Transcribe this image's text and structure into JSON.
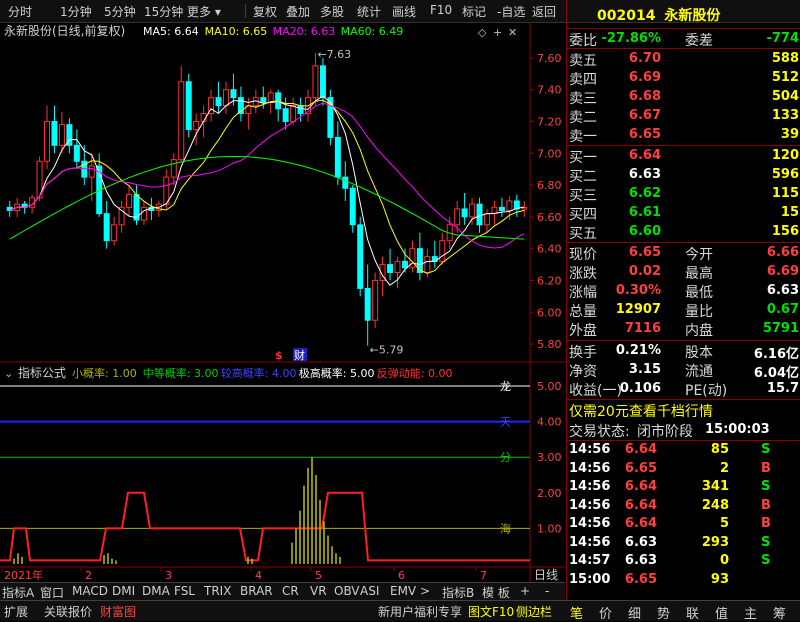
{
  "toolbar": {
    "items": [
      "分时",
      "1分钟",
      "5分钟",
      "15分钟",
      "更多",
      "复权",
      "叠加",
      "多股",
      "统计",
      "画线",
      "F10",
      "标记",
      "-自选",
      "返回"
    ]
  },
  "chart": {
    "title": "永新股份(日线,前复权)",
    "ma_labels": [
      {
        "text": "MA5: 6.64",
        "color": "#ffffff"
      },
      {
        "text": "MA10: 6.65",
        "color": "#ffff00"
      },
      {
        "text": "MA20: 6.63",
        "color": "#ff00ff"
      },
      {
        "text": "MA60: 6.49",
        "color": "#00ff00"
      }
    ],
    "price_ticks": [
      "7.60",
      "7.40",
      "7.20",
      "7.00",
      "6.80",
      "6.60",
      "6.40",
      "6.20",
      "6.00",
      "5.80"
    ],
    "high_label": "7.63",
    "low_label": "5.79",
    "markers": {
      "s": "$",
      "cai": "财"
    },
    "indicator": {
      "name": "指标公式",
      "params": [
        {
          "text": "小概率: 1.00",
          "color": "#b0b000"
        },
        {
          "text": "中等概率: 3.00",
          "color": "#00d000"
        },
        {
          "text": "较高概率: 4.00",
          "color": "#4040ff"
        },
        {
          "text": "极高概率: 5.00",
          "color": "#ffffff"
        },
        {
          "text": "反弹动能: 0.00",
          "color": "#ff3030"
        }
      ],
      "ticks": [
        "5.00",
        "4.00",
        "3.00",
        "2.00",
        "1.00"
      ],
      "line_labels": [
        {
          "text": "龙",
          "color": "#ffffff"
        },
        {
          "text": "天",
          "color": "#4040ff"
        },
        {
          "text": "分",
          "color": "#00d000"
        },
        {
          "text": "海",
          "color": "#b0b000"
        }
      ]
    },
    "x_labels": [
      "2021年",
      "2",
      "3",
      "4",
      "5",
      "6",
      "7"
    ],
    "x_right_label": "日线"
  },
  "chart_data": {
    "type": "candlestick",
    "ylim": [
      5.75,
      7.7
    ],
    "candles": [
      [
        6.66,
        6.7,
        6.6,
        6.64
      ],
      [
        6.64,
        6.72,
        6.6,
        6.68
      ],
      [
        6.68,
        6.7,
        6.62,
        6.66
      ],
      [
        6.66,
        6.74,
        6.62,
        6.72
      ],
      [
        6.72,
        6.98,
        6.7,
        6.95
      ],
      [
        6.95,
        7.3,
        6.9,
        7.2
      ],
      [
        7.2,
        7.3,
        7.0,
        7.05
      ],
      [
        7.05,
        7.26,
        7.0,
        7.18
      ],
      [
        7.18,
        7.22,
        7.0,
        7.05
      ],
      [
        7.05,
        7.15,
        6.9,
        6.95
      ],
      [
        6.95,
        7.05,
        6.8,
        6.85
      ],
      [
        6.85,
        7.0,
        6.7,
        6.92
      ],
      [
        6.92,
        7.0,
        6.6,
        6.62
      ],
      [
        6.62,
        6.7,
        6.4,
        6.45
      ],
      [
        6.45,
        6.6,
        6.42,
        6.55
      ],
      [
        6.55,
        6.7,
        6.5,
        6.66
      ],
      [
        6.66,
        6.8,
        6.6,
        6.74
      ],
      [
        6.74,
        6.8,
        6.55,
        6.58
      ],
      [
        6.58,
        6.7,
        6.55,
        6.66
      ],
      [
        6.66,
        6.72,
        6.58,
        6.64
      ],
      [
        6.64,
        6.7,
        6.6,
        6.68
      ],
      [
        6.68,
        6.9,
        6.65,
        6.85
      ],
      [
        6.85,
        7.0,
        6.8,
        6.96
      ],
      [
        6.96,
        7.55,
        6.95,
        7.45
      ],
      [
        7.45,
        7.5,
        7.1,
        7.15
      ],
      [
        7.15,
        7.25,
        7.05,
        7.2
      ],
      [
        7.2,
        7.3,
        7.1,
        7.25
      ],
      [
        7.25,
        7.4,
        7.2,
        7.35
      ],
      [
        7.35,
        7.45,
        7.25,
        7.3
      ],
      [
        7.3,
        7.45,
        7.25,
        7.4
      ],
      [
        7.4,
        7.5,
        7.3,
        7.35
      ],
      [
        7.35,
        7.42,
        7.2,
        7.25
      ],
      [
        7.25,
        7.35,
        7.15,
        7.3
      ],
      [
        7.3,
        7.4,
        7.25,
        7.35
      ],
      [
        7.35,
        7.42,
        7.28,
        7.32
      ],
      [
        7.32,
        7.4,
        7.25,
        7.38
      ],
      [
        7.38,
        7.4,
        7.2,
        7.28
      ],
      [
        7.28,
        7.35,
        7.15,
        7.2
      ],
      [
        7.2,
        7.35,
        7.18,
        7.3
      ],
      [
        7.3,
        7.35,
        7.2,
        7.25
      ],
      [
        7.25,
        7.4,
        7.2,
        7.35
      ],
      [
        7.35,
        7.63,
        7.3,
        7.55
      ],
      [
        7.55,
        7.6,
        7.3,
        7.35
      ],
      [
        7.35,
        7.4,
        7.05,
        7.1
      ],
      [
        7.1,
        7.2,
        6.8,
        6.85
      ],
      [
        6.85,
        6.95,
        6.7,
        6.78
      ],
      [
        6.78,
        6.8,
        6.5,
        6.55
      ],
      [
        6.55,
        6.6,
        6.1,
        6.15
      ],
      [
        6.15,
        6.3,
        5.79,
        5.95
      ],
      [
        5.95,
        6.25,
        5.9,
        6.2
      ],
      [
        6.2,
        6.35,
        6.1,
        6.3
      ],
      [
        6.3,
        6.4,
        6.2,
        6.25
      ],
      [
        6.25,
        6.35,
        6.15,
        6.32
      ],
      [
        6.32,
        6.4,
        6.25,
        6.28
      ],
      [
        6.28,
        6.45,
        6.25,
        6.4
      ],
      [
        6.4,
        6.5,
        6.2,
        6.25
      ],
      [
        6.25,
        6.4,
        6.22,
        6.35
      ],
      [
        6.35,
        6.45,
        6.28,
        6.32
      ],
      [
        6.32,
        6.5,
        6.3,
        6.45
      ],
      [
        6.45,
        6.6,
        6.4,
        6.55
      ],
      [
        6.55,
        6.7,
        6.5,
        6.65
      ],
      [
        6.65,
        6.75,
        6.55,
        6.6
      ],
      [
        6.6,
        6.72,
        6.55,
        6.68
      ],
      [
        6.68,
        6.72,
        6.5,
        6.55
      ],
      [
        6.55,
        6.65,
        6.5,
        6.62
      ],
      [
        6.62,
        6.7,
        6.55,
        6.66
      ],
      [
        6.66,
        6.72,
        6.6,
        6.64
      ],
      [
        6.64,
        6.73,
        6.58,
        6.7
      ],
      [
        6.7,
        6.74,
        6.6,
        6.65
      ],
      [
        6.65,
        6.7,
        6.6,
        6.66
      ]
    ]
  },
  "quote": {
    "code": "002014",
    "name": "永新股份",
    "weibi": {
      "label": "委比",
      "value": "-27.86%",
      "label2": "委差",
      "value2": "-774"
    },
    "sell": [
      {
        "label": "卖五",
        "price": "6.70",
        "vol": "588"
      },
      {
        "label": "卖四",
        "price": "6.69",
        "vol": "512"
      },
      {
        "label": "卖三",
        "price": "6.68",
        "vol": "504"
      },
      {
        "label": "卖二",
        "price": "6.67",
        "vol": "133"
      },
      {
        "label": "卖一",
        "price": "6.65",
        "vol": "39"
      }
    ],
    "buy": [
      {
        "label": "买一",
        "price": "6.64",
        "vol": "120",
        "pc": "red"
      },
      {
        "label": "买二",
        "price": "6.63",
        "vol": "596",
        "pc": "white"
      },
      {
        "label": "买三",
        "price": "6.62",
        "vol": "115",
        "pc": "green"
      },
      {
        "label": "买四",
        "price": "6.61",
        "vol": "15",
        "pc": "green"
      },
      {
        "label": "买五",
        "price": "6.60",
        "vol": "156",
        "pc": "green"
      }
    ],
    "stats": [
      {
        "l1": "现价",
        "v1": "6.65",
        "c1": "red",
        "l2": "今开",
        "v2": "6.66",
        "c2": "red"
      },
      {
        "l1": "涨跌",
        "v1": "0.02",
        "c1": "red",
        "l2": "最高",
        "v2": "6.69",
        "c2": "red"
      },
      {
        "l1": "涨幅",
        "v1": "0.30%",
        "c1": "red",
        "l2": "最低",
        "v2": "6.63",
        "c2": "white"
      },
      {
        "l1": "总量",
        "v1": "12907",
        "c1": "yellow",
        "l2": "量比",
        "v2": "0.67",
        "c2": "green"
      },
      {
        "l1": "外盘",
        "v1": "7116",
        "c1": "red",
        "l2": "内盘",
        "v2": "5791",
        "c2": "green"
      }
    ],
    "fund": [
      {
        "l1": "换手",
        "v1": "0.21%",
        "l2": "股本",
        "v2": "6.16亿"
      },
      {
        "l1": "净资",
        "v1": "3.15",
        "l2": "流通",
        "v2": "6.04亿"
      },
      {
        "l1": "收益(一)",
        "v1": "0.106",
        "l2": "PE(动)",
        "v2": "15.7"
      }
    ],
    "promo": "仅需20元查看千档行情",
    "status_label": "交易状态:",
    "status_value": "闭市阶段",
    "status_time": "15:00:03",
    "ticks": [
      {
        "t": "14:56",
        "p": "6.64",
        "pc": "red",
        "v": "85",
        "d": "S"
      },
      {
        "t": "14:56",
        "p": "6.65",
        "pc": "red",
        "v": "2",
        "d": "B"
      },
      {
        "t": "14:56",
        "p": "6.64",
        "pc": "red",
        "v": "341",
        "d": "S"
      },
      {
        "t": "14:56",
        "p": "6.64",
        "pc": "red",
        "v": "248",
        "d": "B"
      },
      {
        "t": "14:56",
        "p": "6.64",
        "pc": "red",
        "v": "5",
        "d": "B"
      },
      {
        "t": "14:56",
        "p": "6.63",
        "pc": "white",
        "v": "293",
        "d": "S"
      },
      {
        "t": "14:57",
        "p": "6.63",
        "pc": "white",
        "v": "0",
        "d": "S"
      },
      {
        "t": "15:00",
        "p": "6.65",
        "pc": "red",
        "v": "93",
        "d": ""
      }
    ]
  },
  "tabs": [
    "指标A",
    "窗口",
    "MACD",
    "DMI",
    "DMA",
    "FSL",
    "TRIX",
    "BRAR",
    "CR",
    "VR",
    "OBV",
    "ASI",
    "EMV",
    ">",
    "指标B",
    "模 板",
    "+",
    "-"
  ],
  "bottom": {
    "left": [
      {
        "text": "扩展",
        "color": "#d0d0d0"
      },
      {
        "text": "关联报价",
        "color": "#d0d0d0"
      },
      {
        "text": "财富图",
        "color": "#ff4040"
      }
    ],
    "right": [
      {
        "text": "新用户福利专享",
        "color": "#d0d0d0"
      },
      {
        "text": "图文F10",
        "color": "#ffff00"
      },
      {
        "text": "侧边栏",
        "color": "#ffff00"
      }
    ],
    "icons": [
      "笔",
      "价",
      "细",
      "势",
      "联",
      "值",
      "主",
      "筹"
    ]
  }
}
